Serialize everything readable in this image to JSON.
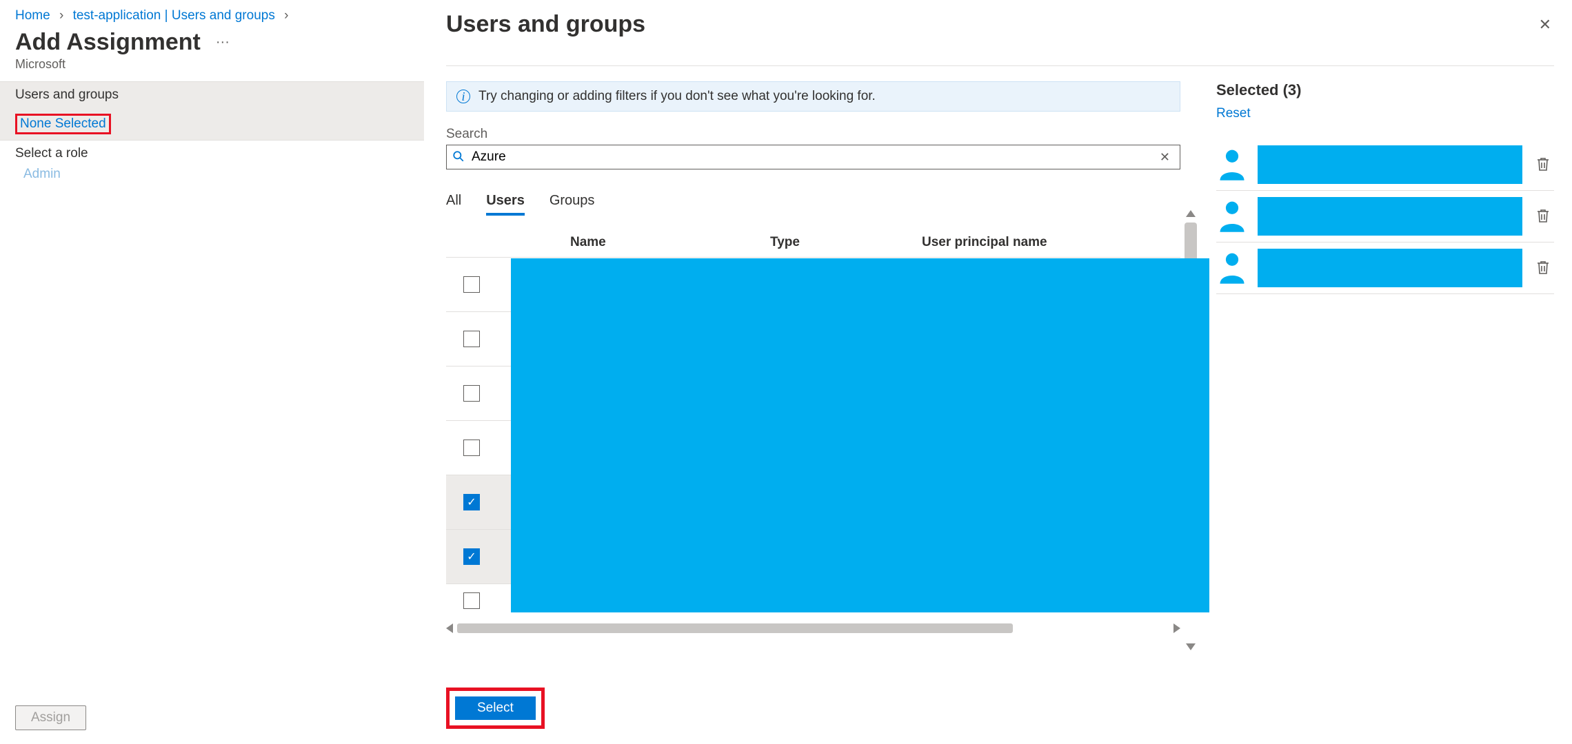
{
  "breadcrumb": {
    "home": "Home",
    "app": "test-application | Users and groups"
  },
  "page": {
    "title": "Add Assignment",
    "subtitle": "Microsoft"
  },
  "left": {
    "section1_label": "Users and groups",
    "none_selected": "None Selected",
    "section2_label": "Select a role",
    "role_value": "Admin",
    "assign_label": "Assign"
  },
  "blade": {
    "title": "Users and groups",
    "info": "Try changing or adding filters if you don't see what you're looking for.",
    "search_label": "Search",
    "search_value": "Azure",
    "tabs": {
      "all": "All",
      "users": "Users",
      "groups": "Groups"
    },
    "columns": {
      "name": "Name",
      "type": "Type",
      "upn": "User principal name"
    },
    "rows": [
      {
        "checked": false
      },
      {
        "checked": false
      },
      {
        "checked": false
      },
      {
        "checked": false
      },
      {
        "checked": true
      },
      {
        "checked": true
      },
      {
        "checked": false,
        "partial": true
      }
    ],
    "select_label": "Select"
  },
  "selected": {
    "title": "Selected (3)",
    "reset": "Reset",
    "count": 3
  }
}
